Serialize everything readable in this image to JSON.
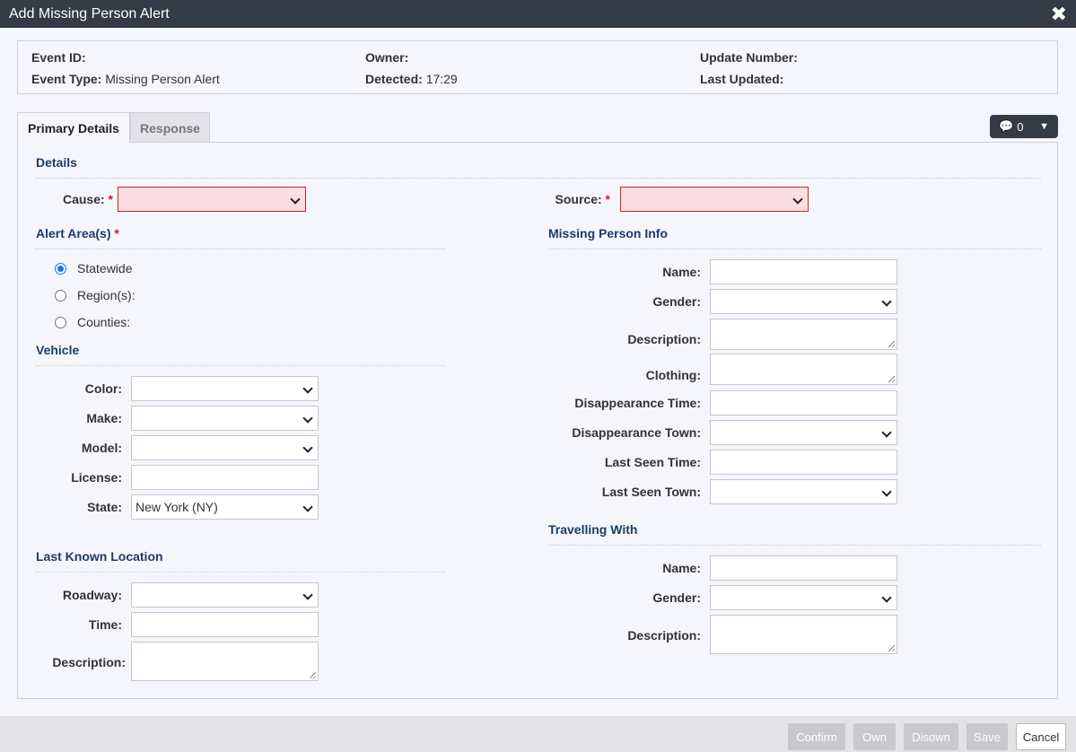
{
  "window": {
    "title": "Add Missing Person Alert"
  },
  "info": {
    "event_id_label": "Event ID:",
    "event_type_label": "Event Type:",
    "event_type_value": "Missing Person Alert",
    "owner_label": "Owner:",
    "detected_label": "Detected:",
    "detected_value": "17:29",
    "update_number_label": "Update Number:",
    "last_updated_label": "Last Updated:"
  },
  "tabs": [
    {
      "label": "Primary Details",
      "active": true
    },
    {
      "label": "Response",
      "active": false
    }
  ],
  "comments": {
    "count": "0"
  },
  "details": {
    "title": "Details",
    "cause_label": "Cause:",
    "source_label": "Source:",
    "required_mark": "*"
  },
  "alert_area": {
    "title": "Alert Area(s)",
    "options": [
      "Statewide",
      "Region(s):",
      "Counties:"
    ],
    "selected": "Statewide"
  },
  "vehicle": {
    "title": "Vehicle",
    "color_label": "Color:",
    "make_label": "Make:",
    "model_label": "Model:",
    "license_label": "License:",
    "state_label": "State:",
    "state_value": "New York (NY)"
  },
  "last_known_location": {
    "title": "Last Known Location",
    "roadway_label": "Roadway:",
    "time_label": "Time:",
    "description_label": "Description:"
  },
  "missing_person": {
    "title": "Missing Person Info",
    "name_label": "Name:",
    "gender_label": "Gender:",
    "description_label": "Description:",
    "clothing_label": "Clothing:",
    "disappearance_time_label": "Disappearance Time:",
    "disappearance_town_label": "Disappearance Town:",
    "last_seen_time_label": "Last Seen Time:",
    "last_seen_town_label": "Last Seen Town:"
  },
  "travelling_with": {
    "title": "Travelling With",
    "name_label": "Name:",
    "gender_label": "Gender:",
    "description_label": "Description:"
  },
  "footer": {
    "confirm": "Confirm",
    "own": "Own",
    "disown": "Disown",
    "save": "Save",
    "cancel": "Cancel"
  },
  "colors": {
    "titlebar": "#343a46",
    "section_title": "#1a3d66",
    "required": "#d02020",
    "invalid_bg": "#f9dde3",
    "radio_checked": "#1a73e8"
  }
}
